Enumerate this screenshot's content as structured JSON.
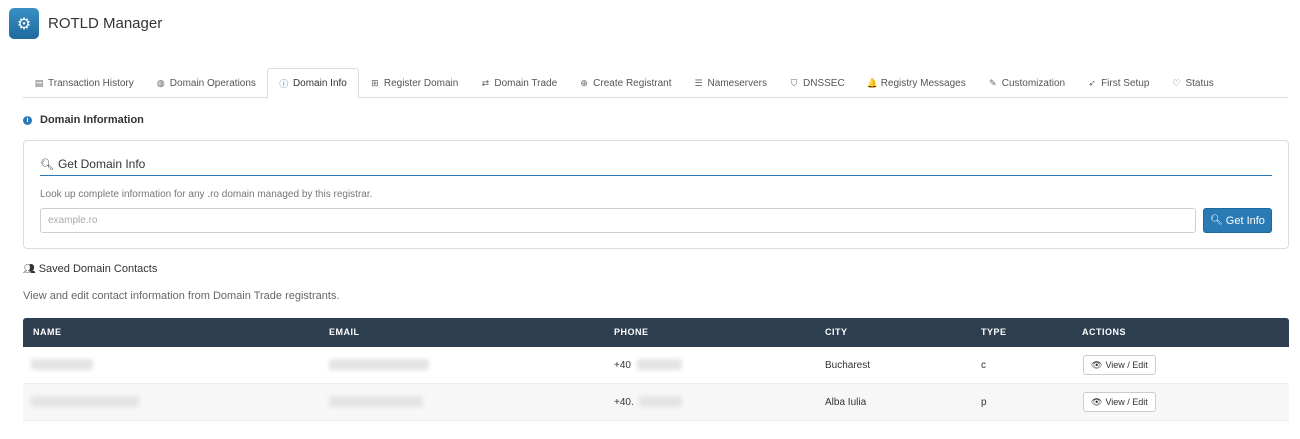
{
  "app": {
    "title": "ROTLD Manager",
    "icon": "gear-icon"
  },
  "tabs": [
    {
      "label": "Transaction History",
      "icon": "list-icon",
      "glyph": "▤",
      "active": false
    },
    {
      "label": "Domain Operations",
      "icon": "globe-icon",
      "glyph": "◍",
      "active": false
    },
    {
      "label": "Domain Info",
      "icon": "info-icon",
      "glyph": "ⓘ",
      "active": true
    },
    {
      "label": "Register Domain",
      "icon": "plus-square-icon",
      "glyph": "⊞",
      "active": false
    },
    {
      "label": "Domain Trade",
      "icon": "exchange-icon",
      "glyph": "⇄",
      "active": false
    },
    {
      "label": "Create Registrant",
      "icon": "plus-circle-icon",
      "glyph": "⊕",
      "active": false
    },
    {
      "label": "Nameservers",
      "icon": "server-icon",
      "glyph": "☰",
      "active": false
    },
    {
      "label": "DNSSEC",
      "icon": "shield-icon",
      "glyph": "⛉",
      "active": false
    },
    {
      "label": "Registry Messages",
      "icon": "bell-icon",
      "glyph": "🔔",
      "active": false
    },
    {
      "label": "Customization",
      "icon": "brush-icon",
      "glyph": "✎",
      "active": false
    },
    {
      "label": "First Setup",
      "icon": "rocket-icon",
      "glyph": "➶",
      "active": false
    },
    {
      "label": "Status",
      "icon": "heartbeat-icon",
      "glyph": "♡",
      "active": false
    }
  ],
  "section": {
    "title": "Domain Information"
  },
  "lookup": {
    "title": "Get Domain Info",
    "description": "Look up complete information for any .ro domain managed by this registrar.",
    "placeholder": "example.ro",
    "button_label": "Get Info"
  },
  "contacts": {
    "title": "Saved Domain Contacts",
    "description": "View and edit contact information from Domain Trade registrants.",
    "columns": [
      "NAME",
      "EMAIL",
      "PHONE",
      "CITY",
      "TYPE",
      "ACTIONS"
    ],
    "rows": [
      {
        "phone_prefix": "+40",
        "city": "Bucharest",
        "type": "c",
        "action": "View / Edit"
      },
      {
        "phone_prefix": "+40.",
        "city": "Alba Iulia",
        "type": "p",
        "action": "View / Edit"
      }
    ]
  },
  "colors": {
    "accent": "#2a7ab6",
    "table_header": "#2c3e50"
  }
}
